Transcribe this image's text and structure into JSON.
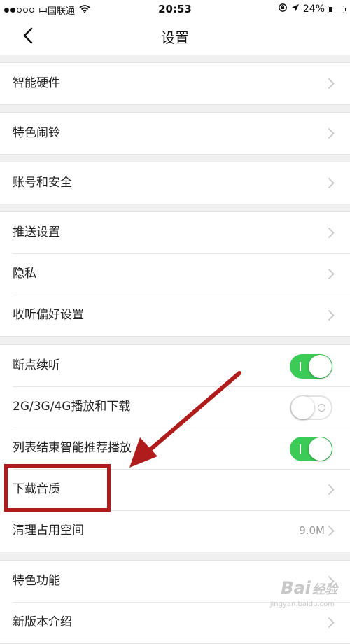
{
  "status_bar": {
    "carrier": "中国联通",
    "time": "20:53",
    "battery_text": "24%",
    "battery_level": 0.24
  },
  "nav": {
    "title": "设置",
    "back_icon": "chevron-left-icon"
  },
  "groups": [
    {
      "rows": [
        {
          "label": "智能硬件",
          "type": "link"
        }
      ]
    },
    {
      "rows": [
        {
          "label": "特色闹铃",
          "type": "link"
        }
      ]
    },
    {
      "rows": [
        {
          "label": "账号和安全",
          "type": "link"
        }
      ]
    },
    {
      "rows": [
        {
          "label": "推送设置",
          "type": "link"
        },
        {
          "label": "隐私",
          "type": "link"
        },
        {
          "label": "收听偏好设置",
          "type": "link"
        }
      ]
    },
    {
      "rows": [
        {
          "label": "断点续听",
          "type": "toggle",
          "on": true
        },
        {
          "label": "2G/3G/4G播放和下载",
          "type": "toggle",
          "on": false
        },
        {
          "label": "列表结束智能推荐播放",
          "type": "toggle",
          "on": true
        },
        {
          "label": "下载音质",
          "type": "link"
        },
        {
          "label": "清理占用空间",
          "type": "link",
          "value": "9.0M"
        }
      ]
    },
    {
      "rows": [
        {
          "label": "特色功能",
          "type": "link"
        },
        {
          "label": "新版本介绍",
          "type": "link"
        }
      ]
    }
  ],
  "watermark": {
    "text": "Bai",
    "sub": "经验",
    "url": "jingyan.baidu.com"
  },
  "colors": {
    "accent_toggle_on": "#3ccb57",
    "annotation_red": "#b01c1c",
    "background": "#f0f0f0"
  }
}
